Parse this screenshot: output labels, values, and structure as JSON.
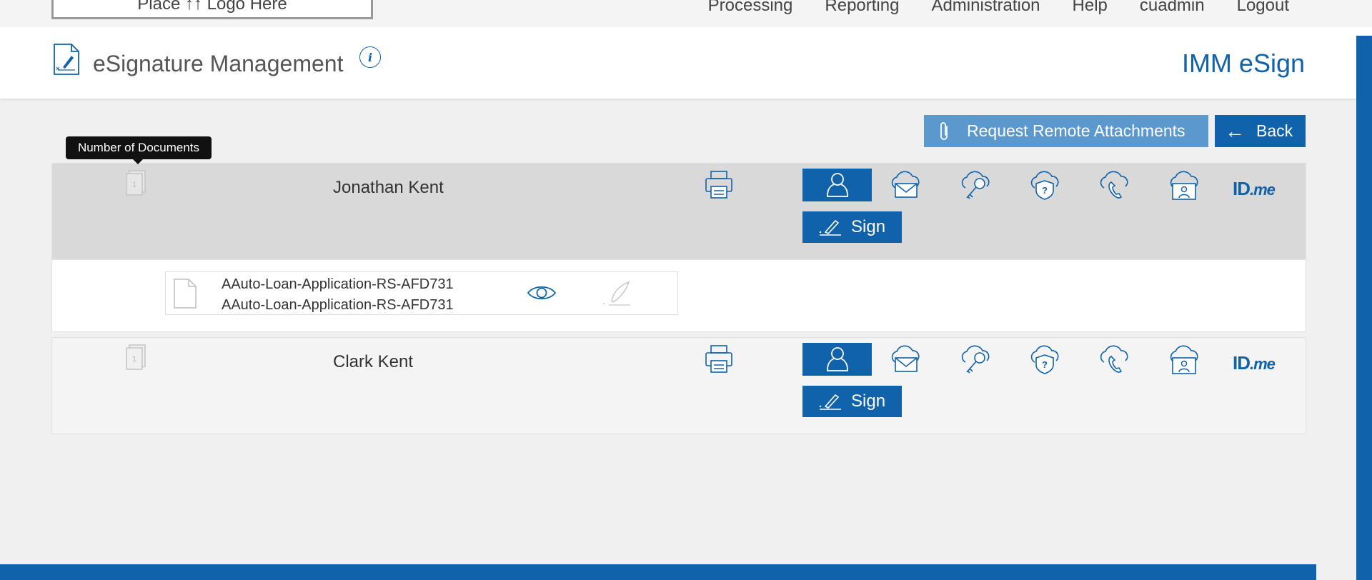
{
  "app": {
    "logo_text": "Place ↑↑ Logo Here",
    "nav": [
      "Processing",
      "Reporting",
      "Administration",
      "Help",
      "cuadmin",
      "Logout"
    ]
  },
  "header": {
    "title": "eSignature Management",
    "info_label": "i",
    "brand": "IMM eSign"
  },
  "actions": {
    "remote_label": "Request Remote Attachments",
    "back_label": "Back"
  },
  "tooltip": {
    "text": "Number of Documents"
  },
  "signers": [
    {
      "name": "Jonathan Kent",
      "doc_count": "1",
      "sign_label": "Sign",
      "idme_prefix": "ID",
      "idme_suffix": ".me"
    },
    {
      "name": "Clark Kent",
      "doc_count": "1",
      "sign_label": "Sign",
      "idme_prefix": "ID",
      "idme_suffix": ".me"
    }
  ],
  "document": {
    "name_line1": "AAuto-Loan-Application-RS-AFD731",
    "name_line2": "AAuto-Loan-Application-RS-AFD731"
  },
  "icons": {
    "auth": [
      "person-icon",
      "cloud-email-icon",
      "cloud-key-icon",
      "cloud-question-icon",
      "cloud-phone-icon",
      "cloud-id-card-icon"
    ],
    "other": [
      "printer-icon",
      "paperclip-icon",
      "eye-icon",
      "pen-icon",
      "document-stack-icon",
      "file-icon"
    ]
  },
  "colors": {
    "primary": "#1062ab",
    "secondary_button": "#5b98cd",
    "selected_row": "#d9d9d9",
    "tooltip_bg": "#111111"
  }
}
